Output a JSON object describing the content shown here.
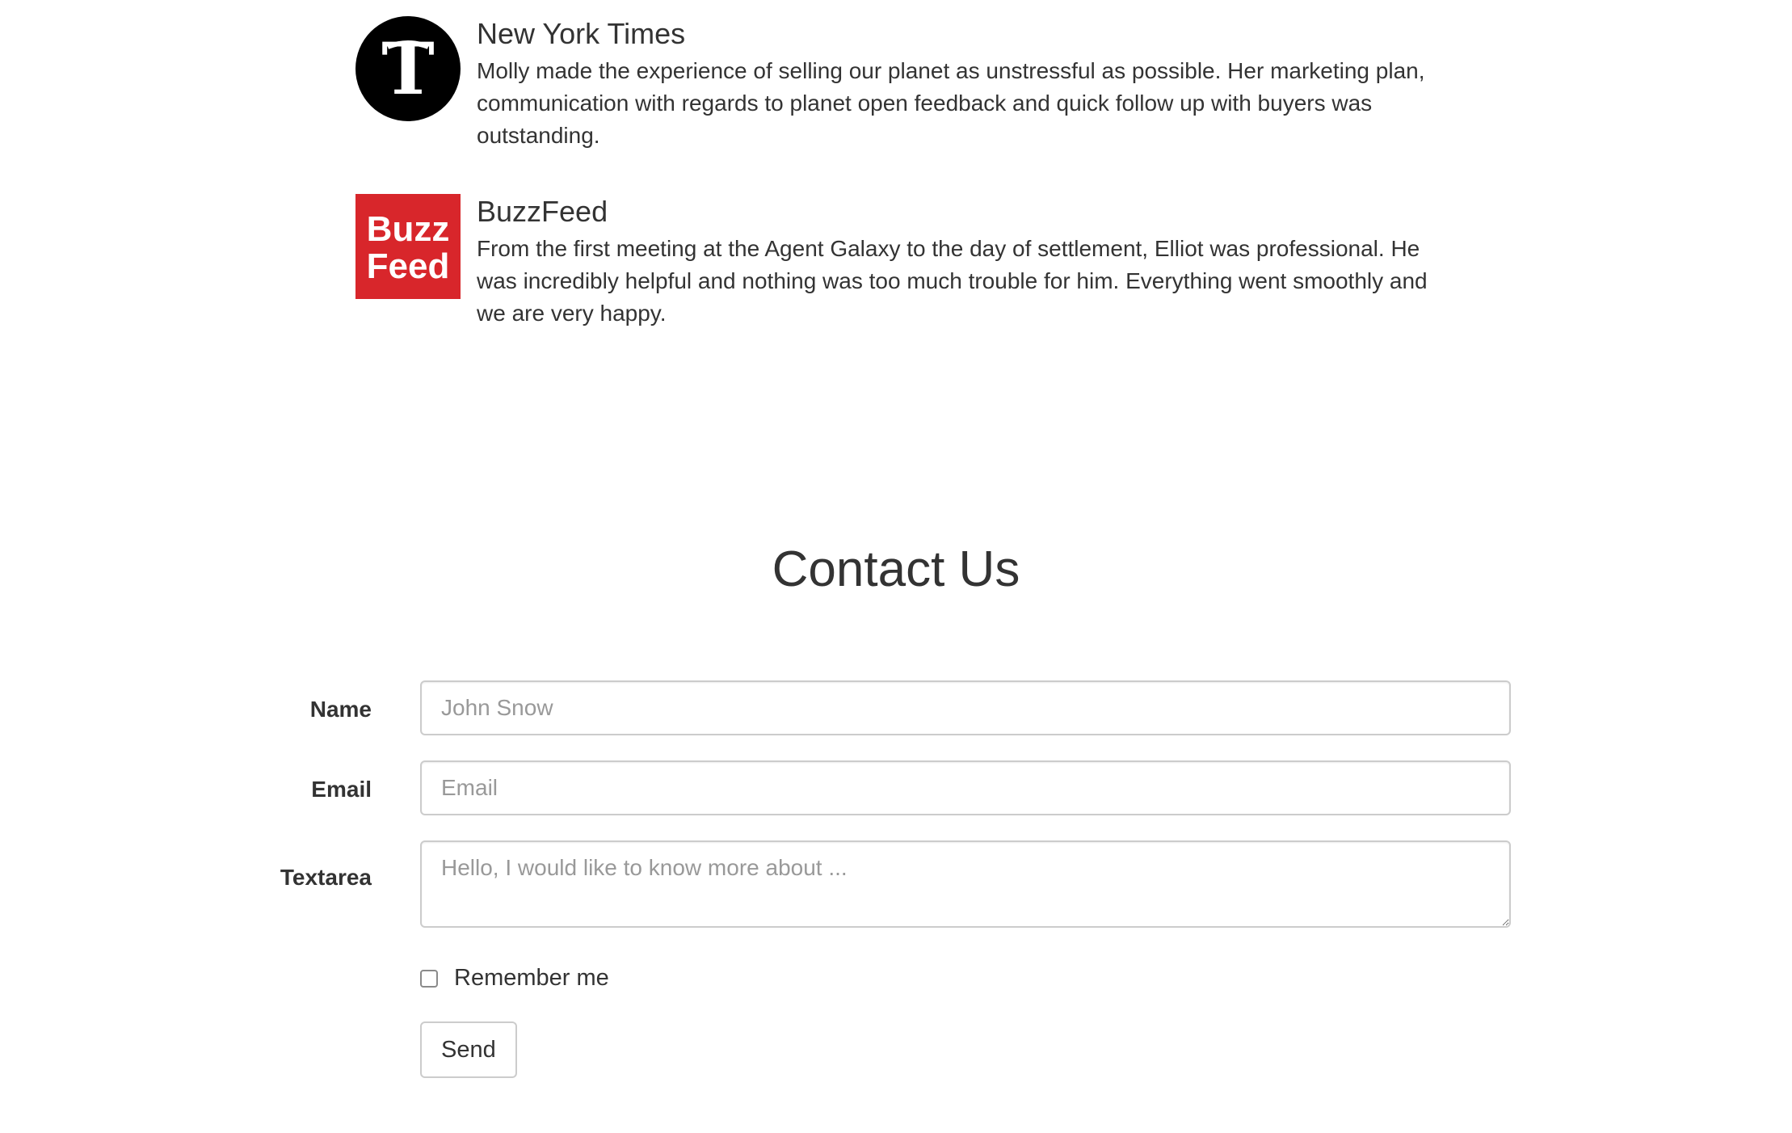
{
  "testimonials": [
    {
      "logo_icon": "new-york-times-logo",
      "logo_color": "#000000",
      "source": "New York Times",
      "quote": "Molly made the experience of selling our planet as unstressful as possible. Her marketing plan, communication with regards to planet open feedback and quick follow up with buyers was outstanding."
    },
    {
      "logo_icon": "buzzfeed-logo",
      "logo_color": "#d8262b",
      "logo_text_top": "Buzz",
      "logo_text_bottom": "Feed",
      "source": "BuzzFeed",
      "quote": "From the first meeting at the Agent Galaxy to the day of settlement, Elliot was professional. He was incredibly helpful and nothing was too much trouble for him. Everything went smoothly and we are very happy."
    }
  ],
  "contact": {
    "title": "Contact Us",
    "name_label": "Name",
    "name_placeholder": "John Snow",
    "email_label": "Email",
    "email_placeholder": "Email",
    "textarea_label": "Textarea",
    "textarea_placeholder": "Hello, I would like to know more about ...",
    "remember_label": "Remember me",
    "remember_checked": false,
    "send_label": "Send"
  }
}
